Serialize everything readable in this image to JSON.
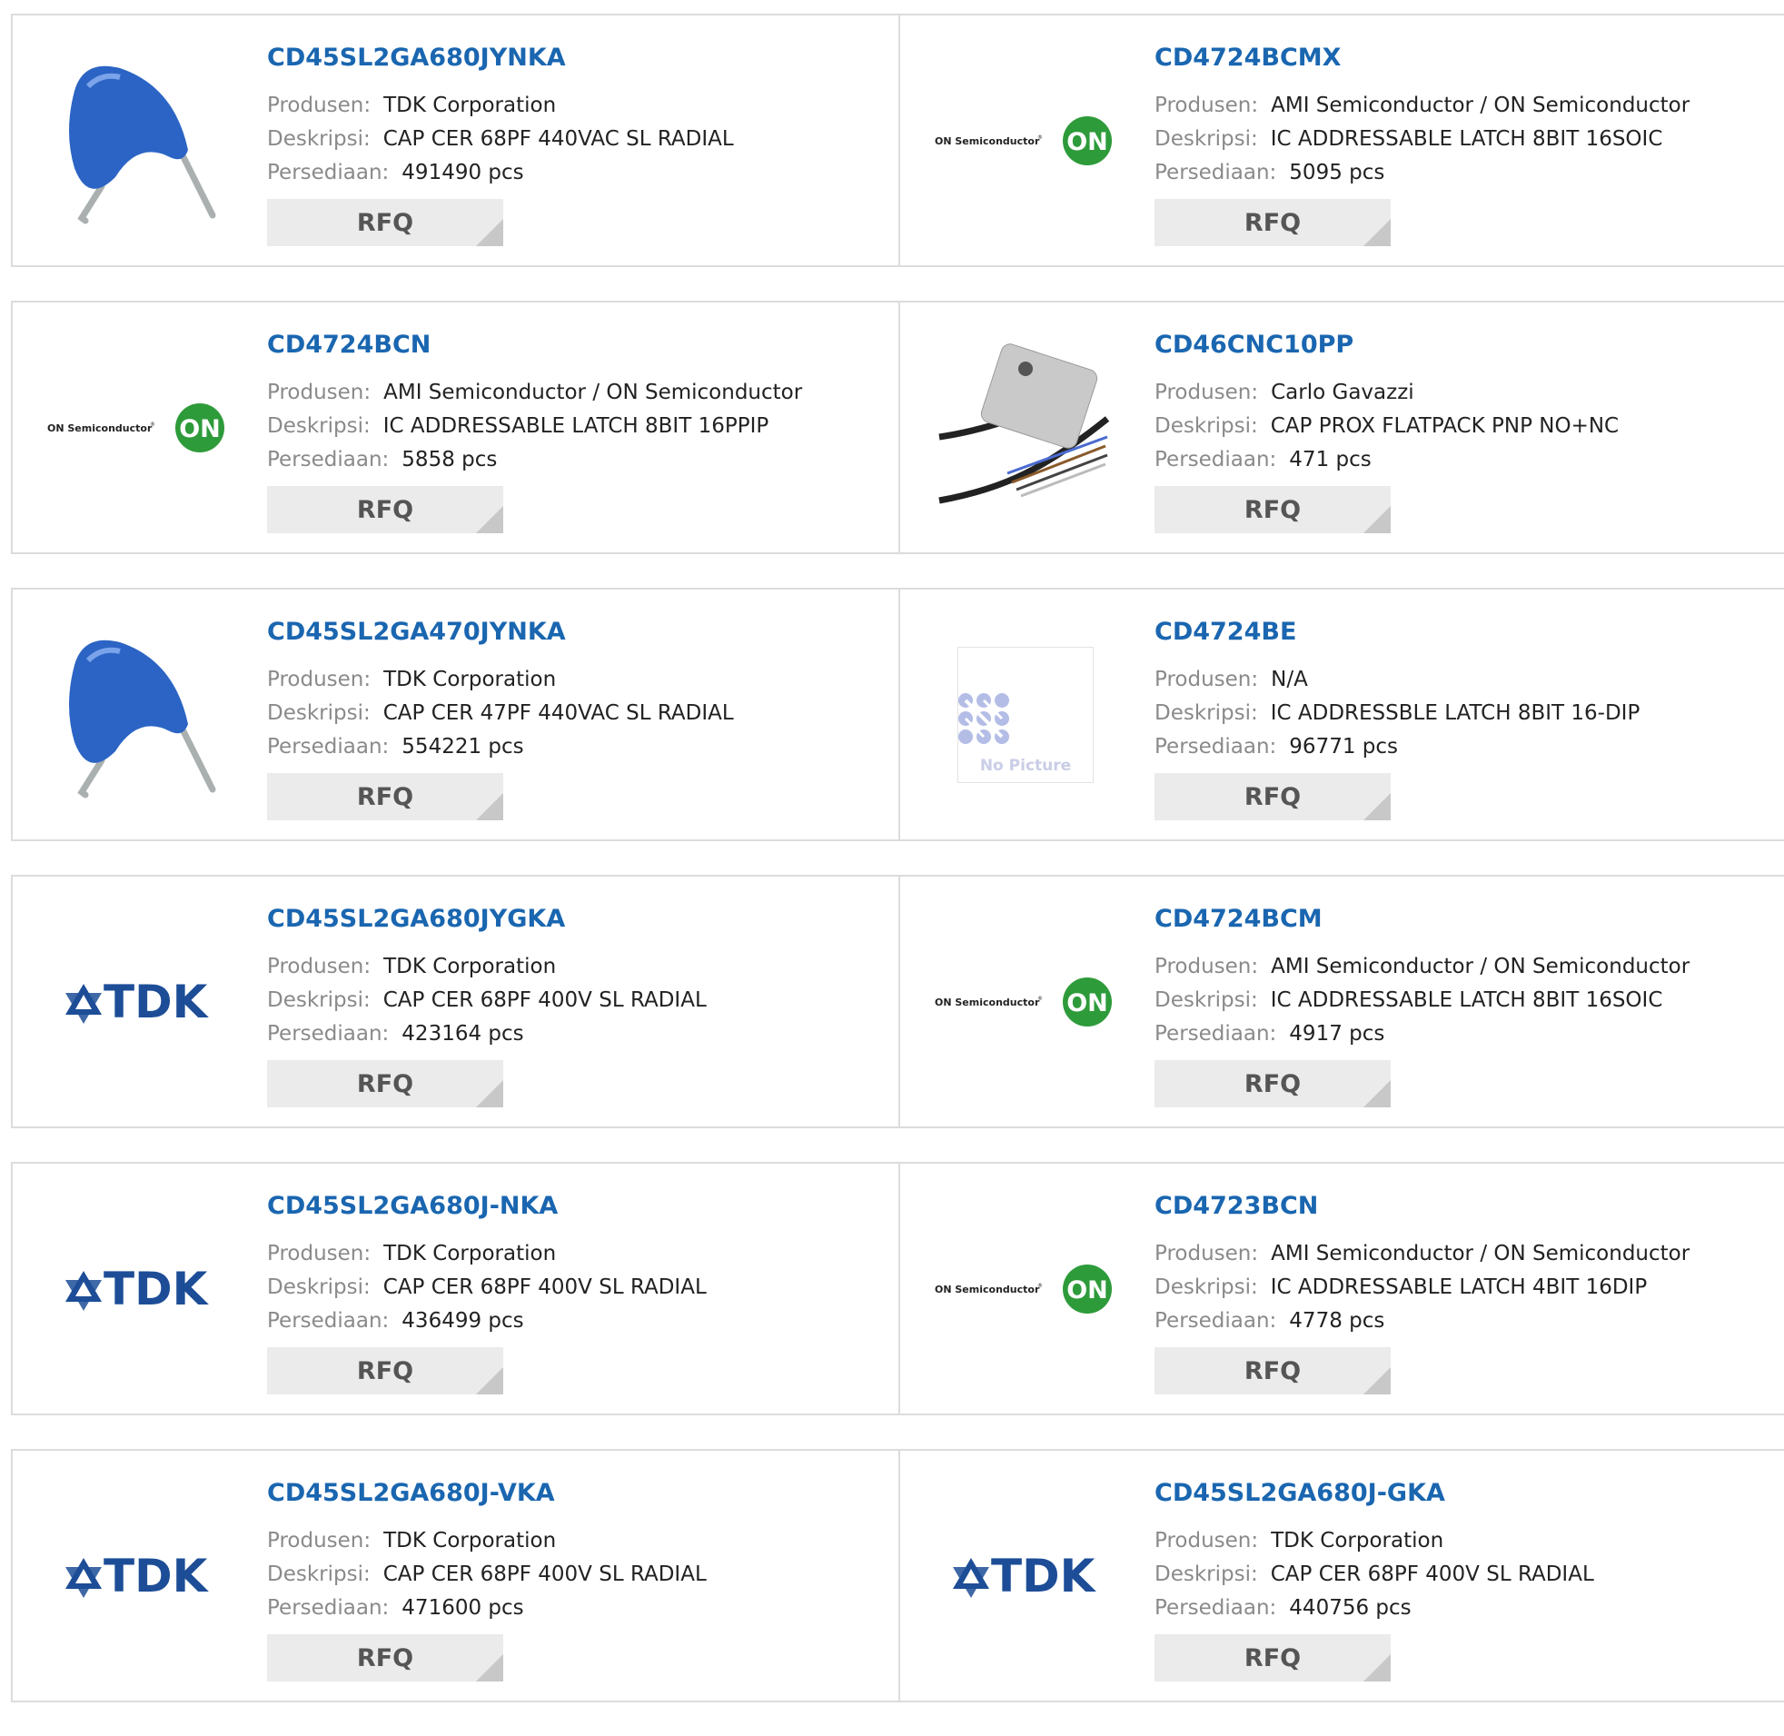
{
  "labels": {
    "manufacturer": "Produsen:",
    "description": "Deskripsi:",
    "stock": "Persediaan:",
    "rfq": "RFQ"
  },
  "nopic_text": "No Picture",
  "products": [
    {
      "part": "CD45SL2GA680JYNKA",
      "manufacturer": "TDK Corporation",
      "description": "CAP CER 68PF 440VAC SL RADIAL",
      "stock": "491490 pcs",
      "image": "blue-capacitor"
    },
    {
      "part": "CD4724BCMX",
      "manufacturer": "AMI Semiconductor / ON Semiconductor",
      "description": "IC ADDRESSABLE LATCH 8BIT 16SOIC",
      "stock": "5095 pcs",
      "image": "on-semi-logo"
    },
    {
      "part": "CD4724BCN",
      "manufacturer": "AMI Semiconductor / ON Semiconductor",
      "description": "IC ADDRESSABLE LATCH 8BIT 16PPIP",
      "stock": "5858 pcs",
      "image": "on-semi-logo"
    },
    {
      "part": "CD46CNC10PP",
      "manufacturer": "Carlo Gavazzi",
      "description": "CAP PROX FLATPACK PNP NO+NC",
      "stock": "471 pcs",
      "image": "proximity-sensor"
    },
    {
      "part": "CD45SL2GA470JYNKA",
      "manufacturer": "TDK Corporation",
      "description": "CAP CER 47PF 440VAC SL RADIAL",
      "stock": "554221 pcs",
      "image": "blue-capacitor"
    },
    {
      "part": "CD4724BE",
      "manufacturer": "N/A",
      "description": "IC ADDRESSBLE LATCH 8BIT 16-DIP",
      "stock": "96771 pcs",
      "image": "no-picture"
    },
    {
      "part": "CD45SL2GA680JYGKA",
      "manufacturer": "TDK Corporation",
      "description": "CAP CER 68PF 400V SL RADIAL",
      "stock": "423164 pcs",
      "image": "tdk-logo"
    },
    {
      "part": "CD4724BCM",
      "manufacturer": "AMI Semiconductor / ON Semiconductor",
      "description": "IC ADDRESSABLE LATCH 8BIT 16SOIC",
      "stock": "4917 pcs",
      "image": "on-semi-logo"
    },
    {
      "part": "CD45SL2GA680J-NKA",
      "manufacturer": "TDK Corporation",
      "description": "CAP CER 68PF 400V SL RADIAL",
      "stock": "436499 pcs",
      "image": "tdk-logo"
    },
    {
      "part": "CD4723BCN",
      "manufacturer": "AMI Semiconductor / ON Semiconductor",
      "description": "IC ADDRESSABLE LATCH 4BIT 16DIP",
      "stock": "4778 pcs",
      "image": "on-semi-logo"
    },
    {
      "part": "CD45SL2GA680J-VKA",
      "manufacturer": "TDK Corporation",
      "description": "CAP CER 68PF 400V SL RADIAL",
      "stock": "471600 pcs",
      "image": "tdk-logo"
    },
    {
      "part": "CD45SL2GA680J-GKA",
      "manufacturer": "TDK Corporation",
      "description": "CAP CER 68PF 400V SL RADIAL",
      "stock": "440756 pcs",
      "image": "tdk-logo"
    }
  ],
  "colors": {
    "link": "#1a66b0",
    "label": "#8a8a8a",
    "border": "#dcdcdc",
    "button_bg": "#ebebeb"
  }
}
